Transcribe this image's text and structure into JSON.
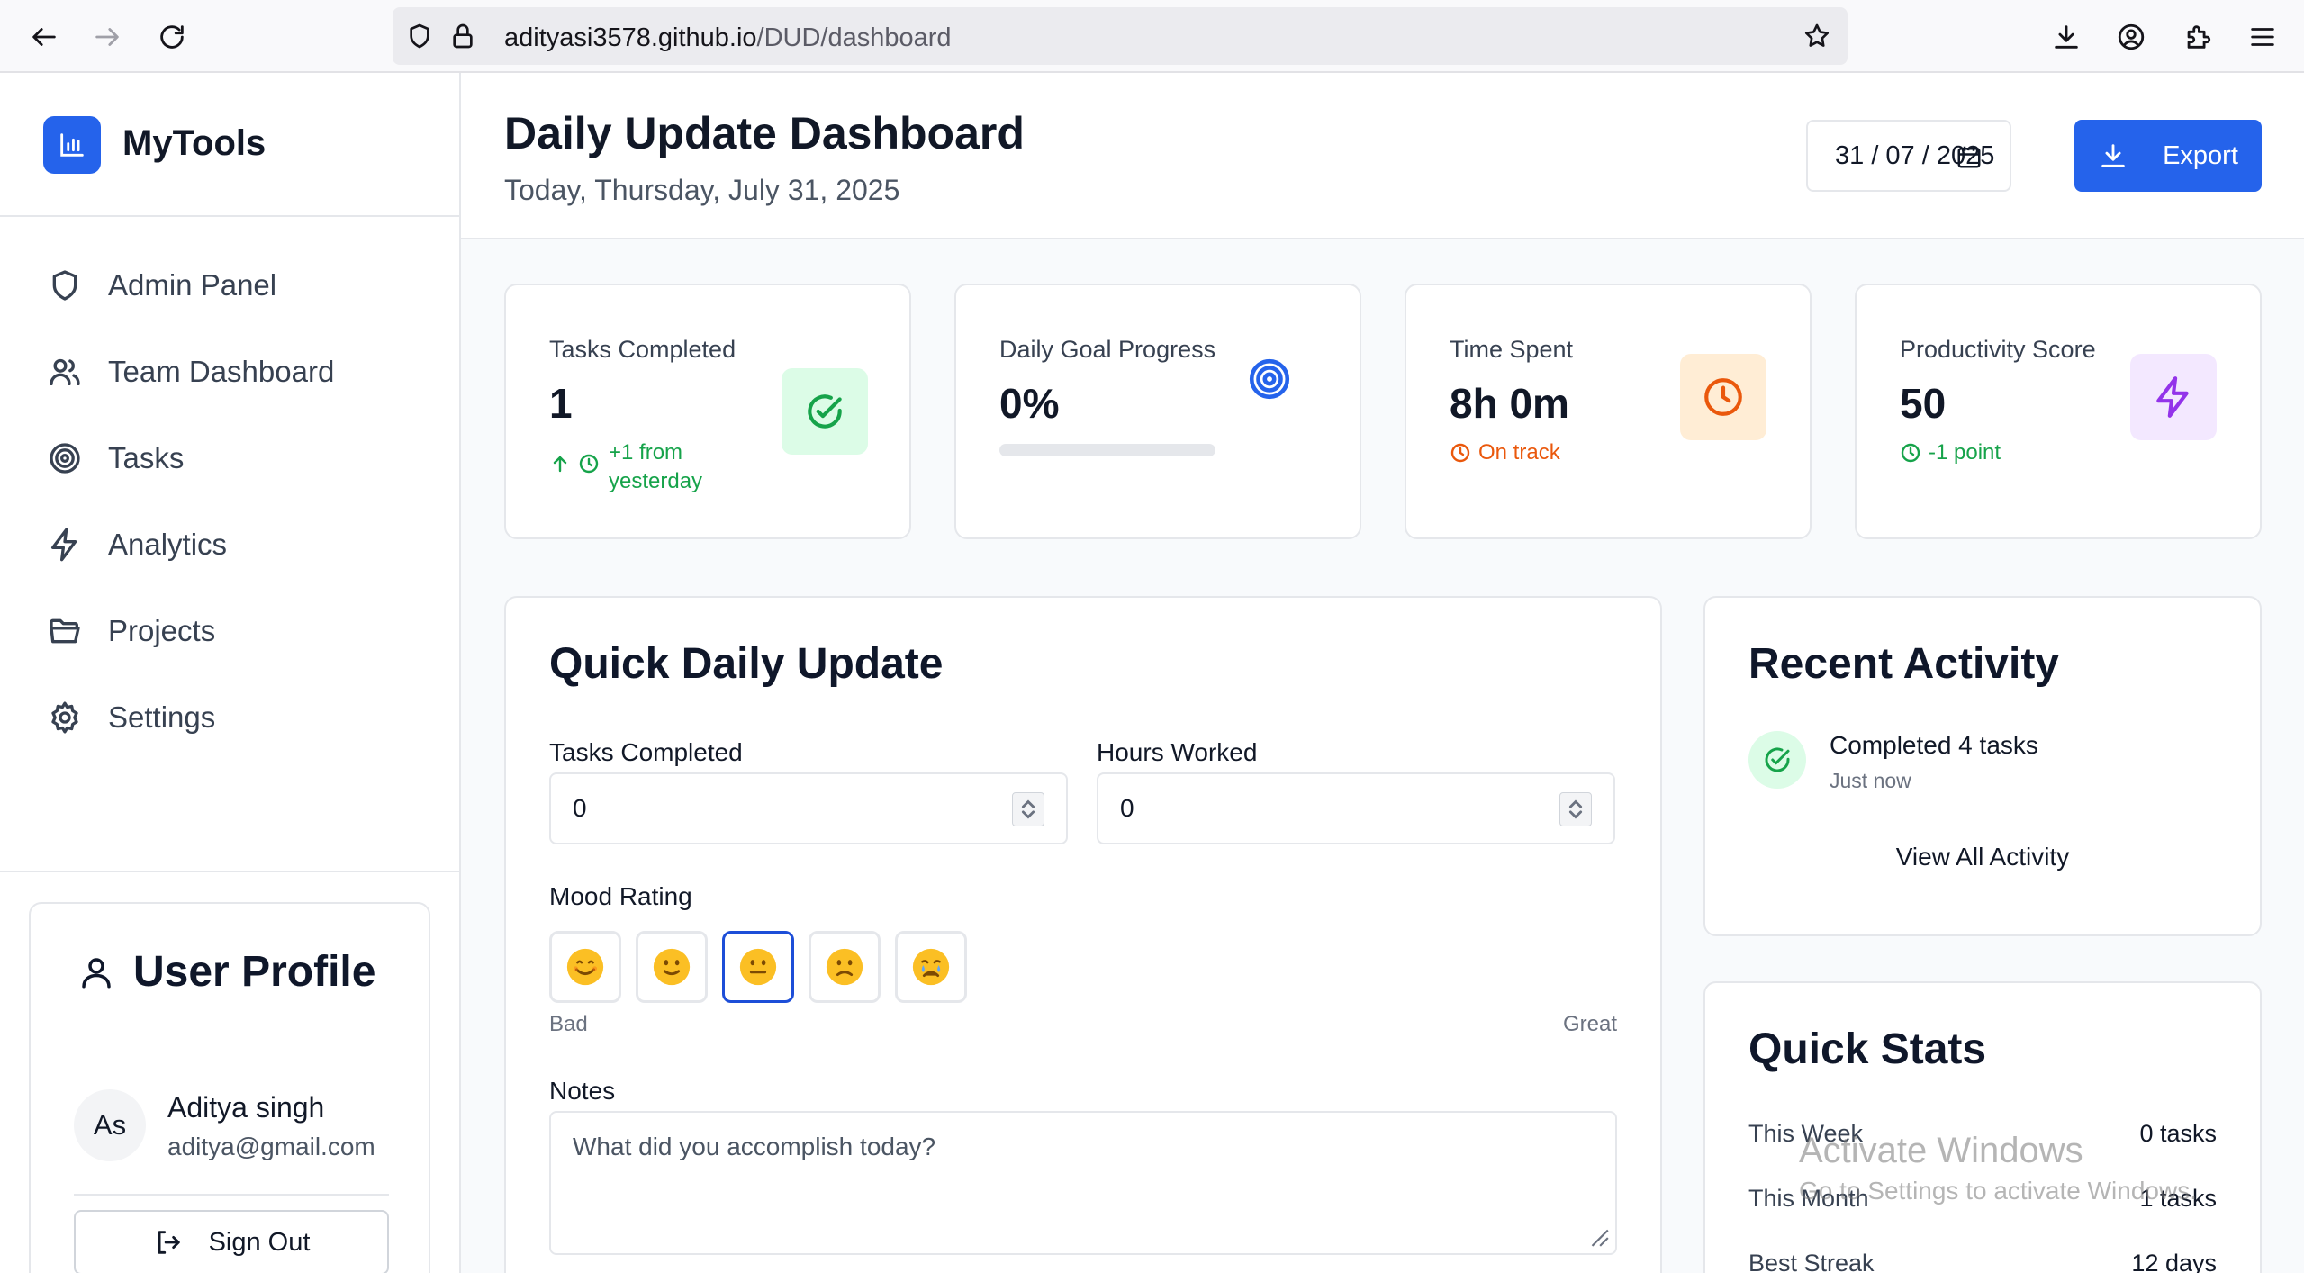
{
  "browser": {
    "url_host": "adityasi3578.github.io",
    "url_path": "/DUD/dashboard"
  },
  "sidebar": {
    "brand": "MyTools",
    "items": [
      {
        "label": "Admin Panel",
        "icon": "shield-icon"
      },
      {
        "label": "Team Dashboard",
        "icon": "users-icon"
      },
      {
        "label": "Tasks",
        "icon": "target-icon"
      },
      {
        "label": "Analytics",
        "icon": "zap-icon"
      },
      {
        "label": "Projects",
        "icon": "folder-icon"
      },
      {
        "label": "Settings",
        "icon": "gear-icon"
      }
    ],
    "profile": {
      "title": "User Profile",
      "initials": "As",
      "name": "Aditya singh",
      "email": "aditya@gmail.com",
      "signout_label": "Sign Out"
    }
  },
  "header": {
    "title": "Daily Update Dashboard",
    "subtitle": "Today, Thursday, July 31, 2025",
    "date_value": "31 / 07 / 2025",
    "export_label": "Export"
  },
  "stats": [
    {
      "label": "Tasks Completed",
      "value": "1",
      "note": "+1 from yesterday",
      "note_color": "#16a34a",
      "icon": "check-circle-icon",
      "icon_bg": "#dcfce7",
      "icon_color": "#16a34a"
    },
    {
      "label": "Daily Goal Progress",
      "value": "0%",
      "progress": 0,
      "icon": "target-icon",
      "icon_color": "#2563eb"
    },
    {
      "label": "Time Spent",
      "value": "8h 0m",
      "note": "On track",
      "note_color": "#ea580c",
      "icon": "clock-icon",
      "icon_bg": "#ffedd5",
      "icon_color": "#ea580c"
    },
    {
      "label": "Productivity Score",
      "value": "50",
      "note": "-1 point",
      "note_color": "#16a34a",
      "icon": "zap-icon",
      "icon_bg": "#f3e8ff",
      "icon_color": "#9333ea"
    }
  ],
  "quick_update": {
    "title": "Quick Daily Update",
    "tasks_label": "Tasks Completed",
    "tasks_value": "0",
    "hours_label": "Hours Worked",
    "hours_value": "0",
    "mood_label": "Mood Rating",
    "mood_low": "Bad",
    "mood_high": "Great",
    "moods": [
      "smiling-face",
      "slight-smile-face",
      "neutral-face",
      "frowning-face",
      "crying-face"
    ],
    "mood_selected_index": 2,
    "notes_label": "Notes",
    "notes_placeholder": "What did you accomplish today?"
  },
  "recent_activity": {
    "title": "Recent Activity",
    "items": [
      {
        "text": "Completed 4 tasks",
        "time": "Just now"
      }
    ],
    "view_all": "View All Activity"
  },
  "quick_stats": {
    "title": "Quick Stats",
    "rows": [
      {
        "label": "This Week",
        "value": "0 tasks"
      },
      {
        "label": "This Month",
        "value": "1 tasks"
      },
      {
        "label": "Best Streak",
        "value": "12 days"
      }
    ]
  },
  "watermark": {
    "line1": "Activate Windows",
    "line2": "Go to Settings to activate Windows."
  },
  "colors": {
    "accent": "#2563eb",
    "success": "#16a34a",
    "warning": "#ea580c",
    "purple": "#9333ea"
  }
}
